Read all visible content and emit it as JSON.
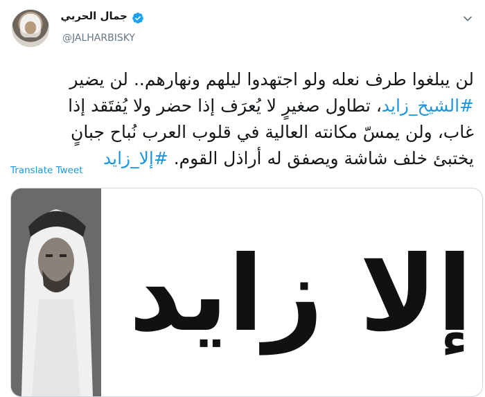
{
  "author": {
    "display_name": "جمال الحربي",
    "handle": "@JALHARBISKY",
    "verified": true
  },
  "tweet": {
    "line1": "لن يبلغوا طرف نعله ولو اجتهدوا ليلهم ونهارهم.. لن يضير",
    "line2_hashtag": "#الشيخ_زايد",
    "line2_rest": "، تطاول صغيرٍ لا يُعرَف إذا حضر ولا يُفتَقد إذا",
    "line3": "غاب، ولن يمسّ مكانته العالية في قلوب العرب نُباح جبانٍ",
    "line4_text": "يختبئ خلف شاشة ويصفق له أراذل القوم.",
    "line4_hashtag": "#إلا_زايد",
    "translate_label": "Translate Tweet"
  },
  "media": {
    "headline": "إلا زايد"
  },
  "colors": {
    "link": "#1b95e0",
    "text": "#14171a",
    "secondary": "#657786"
  }
}
